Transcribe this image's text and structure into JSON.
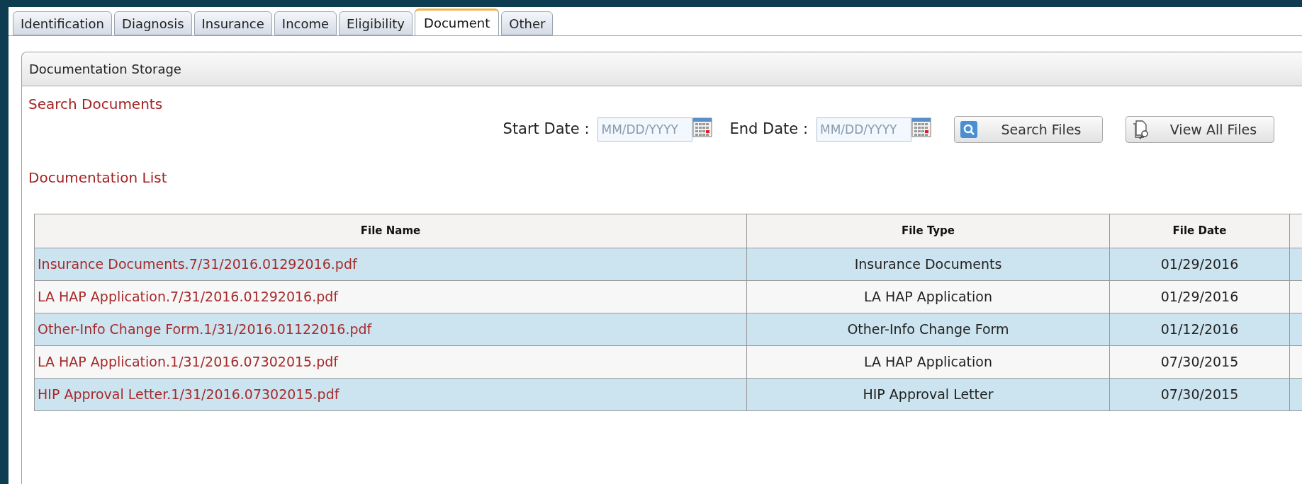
{
  "tabs": [
    {
      "label": "Identification",
      "selected": false
    },
    {
      "label": "Diagnosis",
      "selected": false
    },
    {
      "label": "Insurance",
      "selected": false
    },
    {
      "label": "Income",
      "selected": false
    },
    {
      "label": "Eligibility",
      "selected": false
    },
    {
      "label": "Document",
      "selected": true
    },
    {
      "label": "Other",
      "selected": false
    }
  ],
  "panel": {
    "title": "Documentation Storage",
    "search_heading": "Search Documents",
    "start_date": {
      "label": "Start Date :",
      "placeholder": "MM/DD/YYYY"
    },
    "end_date": {
      "label": "End Date :",
      "placeholder": "MM/DD/YYYY"
    },
    "buttons": [
      {
        "kind": "search",
        "label": "Search Files"
      },
      {
        "kind": "view",
        "label": "View All Files"
      }
    ],
    "list_heading": "Documentation List",
    "table": {
      "columns": [
        "File Name",
        "File Type",
        "File Date"
      ],
      "rows": [
        {
          "file_name": "Insurance Documents.7/31/2016.01292016.pdf",
          "file_type": "Insurance Documents",
          "file_date": "01/29/2016"
        },
        {
          "file_name": "LA HAP Application.7/31/2016.01292016.pdf",
          "file_type": "LA HAP Application",
          "file_date": "01/29/2016"
        },
        {
          "file_name": "Other-Info Change Form.1/31/2016.01122016.pdf",
          "file_type": "Other-Info Change Form",
          "file_date": "01/12/2016"
        },
        {
          "file_name": "LA HAP Application.1/31/2016.07302015.pdf",
          "file_type": "LA HAP Application",
          "file_date": "07/30/2015"
        },
        {
          "file_name": "HIP Approval Letter.1/31/2016.07302015.pdf",
          "file_type": "HIP Approval Letter",
          "file_date": "07/30/2015"
        }
      ]
    }
  }
}
